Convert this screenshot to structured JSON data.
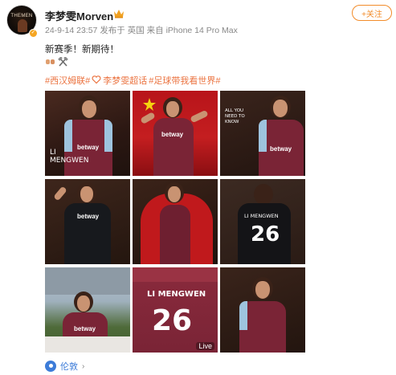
{
  "post": {
    "username": "李梦雯Morven",
    "timestamp": "24-9-14 23:57",
    "meta_source": "发布于 英国  来自 iPhone 14 Pro Max",
    "follow_label": "+关注",
    "text": "新赛季！新期待！",
    "emoji_icons": [
      "fist-bump-icon",
      "hammers-icon"
    ],
    "hashtags": [
      "#西汉姆联#",
      "李梦雯超话",
      "#足球带我看世界#"
    ],
    "photo_texts": {
      "p1_name_line1": "LI",
      "p1_name_line2": "MENGWEN",
      "p3_text": "ALL YOU NEED TO KNOW",
      "p6_number": "26",
      "p6_name": "LI MENGWEN",
      "p8_name": "LI MENGWEN",
      "p8_number": "26",
      "sponsor": "betway"
    },
    "live_label": "Live",
    "location_label": "伦敦"
  },
  "colors": {
    "accent_orange": "#f28c2a",
    "hashtag_orange": "#eb7340",
    "link_blue": "#3d7cd8",
    "claret": "#7a2436"
  }
}
